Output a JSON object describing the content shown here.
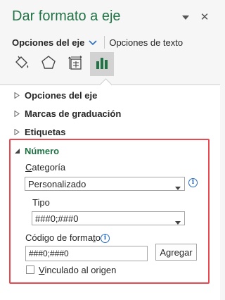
{
  "header": {
    "title": "Dar formato a eje",
    "dropdown_icon": "chevron-down-icon",
    "close_icon": "close-icon",
    "close_glyph": "✕"
  },
  "tabs": [
    {
      "label": "Opciones del eje",
      "active": true
    },
    {
      "label": "Opciones de texto",
      "active": false
    }
  ],
  "toolbar_icons": [
    {
      "name": "fill-line-icon",
      "selected": false
    },
    {
      "name": "effects-icon",
      "selected": false
    },
    {
      "name": "size-properties-icon",
      "selected": false
    },
    {
      "name": "axis-options-icon",
      "selected": true
    }
  ],
  "sections": [
    {
      "label": "Opciones del eje",
      "expanded": false
    },
    {
      "label": "Marcas de graduación",
      "expanded": false
    },
    {
      "label": "Etiquetas",
      "expanded": false
    },
    {
      "label": "Número",
      "expanded": true
    }
  ],
  "number": {
    "category_label": "Categoría",
    "category_value": "Personalizado",
    "type_label": "Tipo",
    "type_value": "###0;###0",
    "format_code_label": "Código de formato",
    "format_code_value": "###0;###0",
    "add_button": "Agregar",
    "linked_label": "Vinculado al origen",
    "linked_checked": false
  },
  "colors": {
    "accent": "#217346",
    "highlight": "#e8484f",
    "info": "#2a6cc2"
  }
}
